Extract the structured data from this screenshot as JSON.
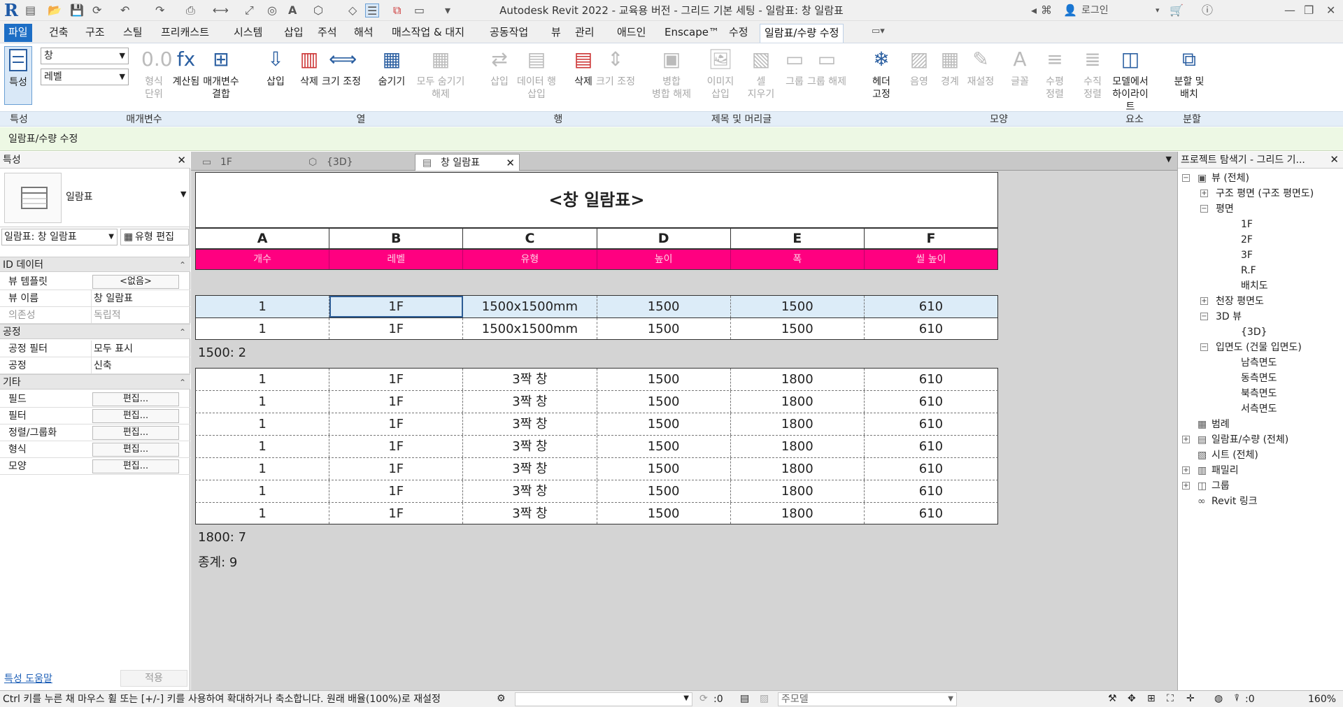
{
  "window": {
    "title": "Autodesk Revit 2022 - 교육용 버전 - 그리드 기본 세팅 - 일람표: 창 일람표",
    "login": "로그인"
  },
  "menu": {
    "tabs": [
      "파일",
      "건축",
      "구조",
      "스틸",
      "프리캐스트",
      "시스템",
      "삽입",
      "주석",
      "해석",
      "매스작업 & 대지",
      "공동작업",
      "뷰",
      "관리",
      "애드인",
      "Enscape™",
      "수정",
      "일람표/수량 수정"
    ]
  },
  "ribbon": {
    "category_value": "창",
    "level_value": "레벨",
    "buttons": {
      "properties": "특성",
      "format_unit": "형식\n단위",
      "calculated": "계산됨",
      "combine_params": "매개변수\n결합",
      "insert_col": "삽입",
      "delete_col": "삭제",
      "resize_col": "크기 조정",
      "hide": "숨기기",
      "unhide_all": "모두 숨기기\n해제",
      "insert_row": "삽입",
      "insert_data_row": "데이터 행\n삽입",
      "delete_row": "삭제",
      "resize_row": "크기 조정",
      "merge_unmerge": "병합\n병합 해제",
      "insert_image": "이미지\n삽입",
      "clear_cell": "셀\n지우기",
      "group": "그룹",
      "ungroup": "그룹 해제",
      "freeze_header": "헤더\n고정",
      "shading": "음영",
      "borders": "경계",
      "reset": "재설정",
      "font": "글꼴",
      "align_horizontal": "수평\n정렬",
      "align_vertical": "수직\n정렬",
      "highlight_in_model": "모델에서\n하이라이트",
      "split_place": "분할 및\n배치"
    },
    "panels": [
      "특성",
      "매개변수",
      "열",
      "행",
      "제목 및 머리글",
      "모양",
      "요소",
      "분할"
    ]
  },
  "context_label": "일람표/수량 수정",
  "properties": {
    "header": "특성",
    "type_name": "일람표",
    "instance_select": "일람표: 창 일람표",
    "edit_type": "유형 편집",
    "sections": [
      {
        "name": "ID 데이터",
        "rows": [
          {
            "key": "뷰 템플릿",
            "value": "<없음>",
            "button": true
          },
          {
            "key": "뷰 이름",
            "value": "창 일람표"
          },
          {
            "key": "의존성",
            "value": "독립적",
            "disabled": true
          }
        ]
      },
      {
        "name": "공정",
        "rows": [
          {
            "key": "공정 필터",
            "value": "모두 표시"
          },
          {
            "key": "공정",
            "value": "신축"
          }
        ]
      },
      {
        "name": "기타",
        "rows": [
          {
            "key": "필드",
            "value": "편집...",
            "button": true
          },
          {
            "key": "필터",
            "value": "편집...",
            "button": true
          },
          {
            "key": "정렬/그룹화",
            "value": "편집...",
            "button": true
          },
          {
            "key": "형식",
            "value": "편집...",
            "button": true
          },
          {
            "key": "모양",
            "value": "편집...",
            "button": true
          }
        ]
      }
    ],
    "help_link": "특성 도움말",
    "apply": "적용"
  },
  "view_tabs": [
    {
      "label": "1F"
    },
    {
      "label": "{3D}"
    },
    {
      "label": "창 일람표",
      "active": true
    }
  ],
  "schedule": {
    "title": "<창 일람표>",
    "columns": [
      "A",
      "B",
      "C",
      "D",
      "E",
      "F"
    ],
    "headers": [
      "개수",
      "레벨",
      "유형",
      "높이",
      "폭",
      "씰 높이"
    ],
    "group1": {
      "rows": [
        [
          "1",
          "1F",
          "1500x1500mm",
          "1500",
          "1500",
          "610"
        ],
        [
          "1",
          "1F",
          "1500x1500mm",
          "1500",
          "1500",
          "610"
        ]
      ],
      "footer": "1500: 2"
    },
    "group2": {
      "rows": [
        [
          "1",
          "1F",
          "3짝 창",
          "1500",
          "1800",
          "610"
        ],
        [
          "1",
          "1F",
          "3짝 창",
          "1500",
          "1800",
          "610"
        ],
        [
          "1",
          "1F",
          "3짝 창",
          "1500",
          "1800",
          "610"
        ],
        [
          "1",
          "1F",
          "3짝 창",
          "1500",
          "1800",
          "610"
        ],
        [
          "1",
          "1F",
          "3짝 창",
          "1500",
          "1800",
          "610"
        ],
        [
          "1",
          "1F",
          "3짝 창",
          "1500",
          "1800",
          "610"
        ],
        [
          "1",
          "1F",
          "3짝 창",
          "1500",
          "1800",
          "610"
        ]
      ],
      "footer": "1800: 7"
    },
    "grand_total": "종계: 9",
    "header_color": "#ff0080"
  },
  "browser": {
    "header": "프로젝트 탐색기 - 그리드 기...",
    "nodes": [
      {
        "label": "뷰 (전체)",
        "depth": 0,
        "exp": "-"
      },
      {
        "label": "구조 평면 (구조 평면도)",
        "depth": 1,
        "exp": "+"
      },
      {
        "label": "평면",
        "depth": 1,
        "exp": "-"
      },
      {
        "label": "1F",
        "depth": 2
      },
      {
        "label": "2F",
        "depth": 2
      },
      {
        "label": "3F",
        "depth": 2
      },
      {
        "label": "R.F",
        "depth": 2
      },
      {
        "label": "배치도",
        "depth": 2
      },
      {
        "label": "천장 평면도",
        "depth": 1,
        "exp": "+"
      },
      {
        "label": "3D 뷰",
        "depth": 1,
        "exp": "-"
      },
      {
        "label": "{3D}",
        "depth": 2
      },
      {
        "label": "입면도 (건물 입면도)",
        "depth": 1,
        "exp": "-"
      },
      {
        "label": "남측면도",
        "depth": 2
      },
      {
        "label": "동측면도",
        "depth": 2
      },
      {
        "label": "북측면도",
        "depth": 2
      },
      {
        "label": "서측면도",
        "depth": 2
      },
      {
        "label": "범례",
        "depth": 0
      },
      {
        "label": "일람표/수량 (전체)",
        "depth": 0,
        "exp": "+"
      },
      {
        "label": "시트 (전체)",
        "depth": 0
      },
      {
        "label": "패밀리",
        "depth": 0,
        "exp": "+"
      },
      {
        "label": "그룹",
        "depth": 0,
        "exp": "+"
      },
      {
        "label": "Revit 링크",
        "depth": 0
      }
    ]
  },
  "status": {
    "message": "Ctrl 키를 누른 채 마우스 휠 또는 [+/-] 키를 사용하여 확대하거나 축소합니다. 원래 배율(100%)로 재설정",
    "model": "주모델",
    "zero": ":0",
    "zoom": "160%"
  }
}
